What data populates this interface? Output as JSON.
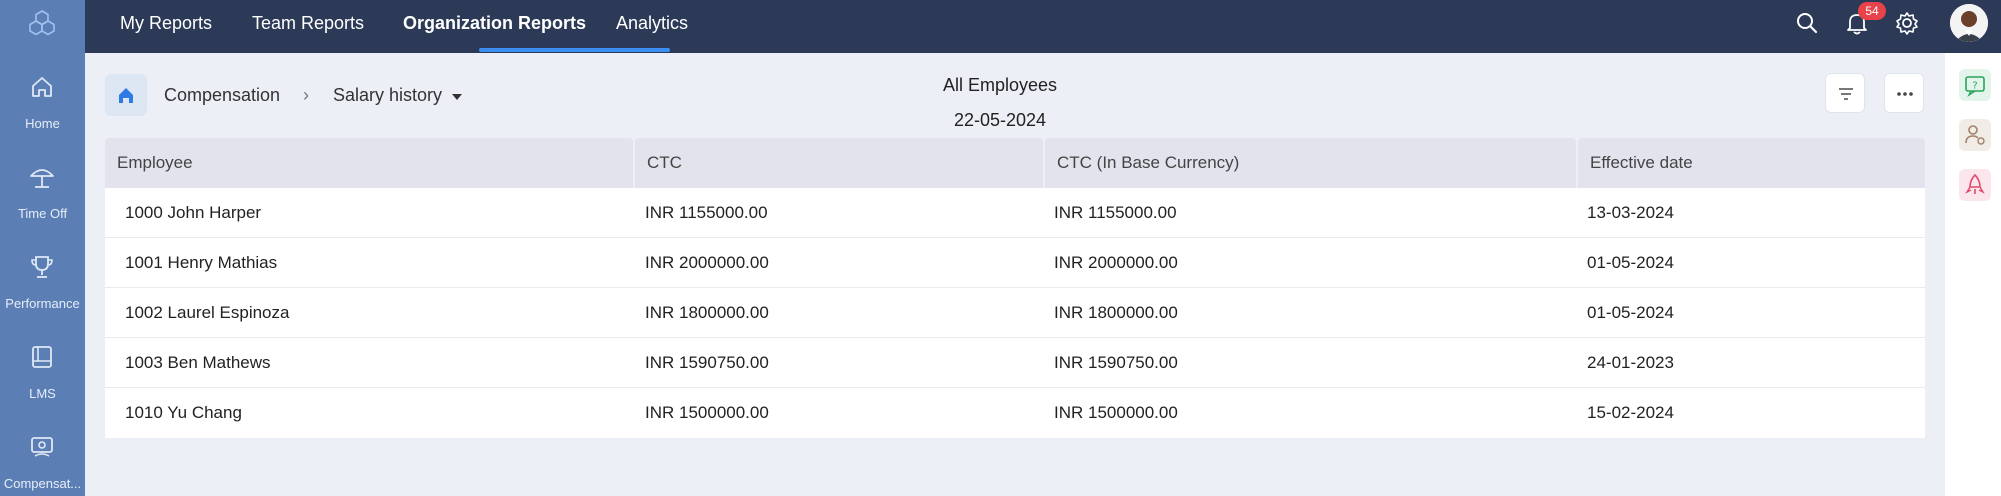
{
  "sidebar": {
    "items": [
      {
        "label": "Home",
        "icon": "home-icon"
      },
      {
        "label": "Time Off",
        "icon": "beach-umbrella-icon"
      },
      {
        "label": "Performance",
        "icon": "trophy-icon"
      },
      {
        "label": "LMS",
        "icon": "book-icon"
      },
      {
        "label": "Compensat...",
        "icon": "compensation-icon"
      }
    ]
  },
  "topbar": {
    "tabs": [
      {
        "label": "My Reports"
      },
      {
        "label": "Team Reports"
      },
      {
        "label": "Organization Reports",
        "active": true
      },
      {
        "label": "Analytics"
      }
    ],
    "notification_count": "54"
  },
  "breadcrumb": {
    "level1": "Compensation",
    "separator": "›",
    "level2": "Salary history"
  },
  "report": {
    "title": "All Employees",
    "date": "22-05-2024"
  },
  "table": {
    "columns": [
      "Employee",
      "CTC",
      "CTC (In Base Currency)",
      "Effective date"
    ],
    "rows": [
      [
        "1000 John Harper",
        "INR 1155000.00",
        "INR 1155000.00",
        "13-03-2024"
      ],
      [
        "1001 Henry Mathias",
        "INR 2000000.00",
        "INR 2000000.00",
        "01-05-2024"
      ],
      [
        "1002 Laurel Espinoza",
        "INR 1800000.00",
        "INR 1800000.00",
        "01-05-2024"
      ],
      [
        "1003 Ben Mathews",
        "INR 1590750.00",
        "INR 1590750.00",
        "24-01-2023"
      ],
      [
        "1010 Yu Chang",
        "INR 1500000.00",
        "INR 1500000.00",
        "15-02-2024"
      ]
    ]
  },
  "colors": {
    "sidebar": "#5b7fb5",
    "topbar": "#2c3a57",
    "accent": "#3b8ff3",
    "badge": "#e8424a"
  }
}
